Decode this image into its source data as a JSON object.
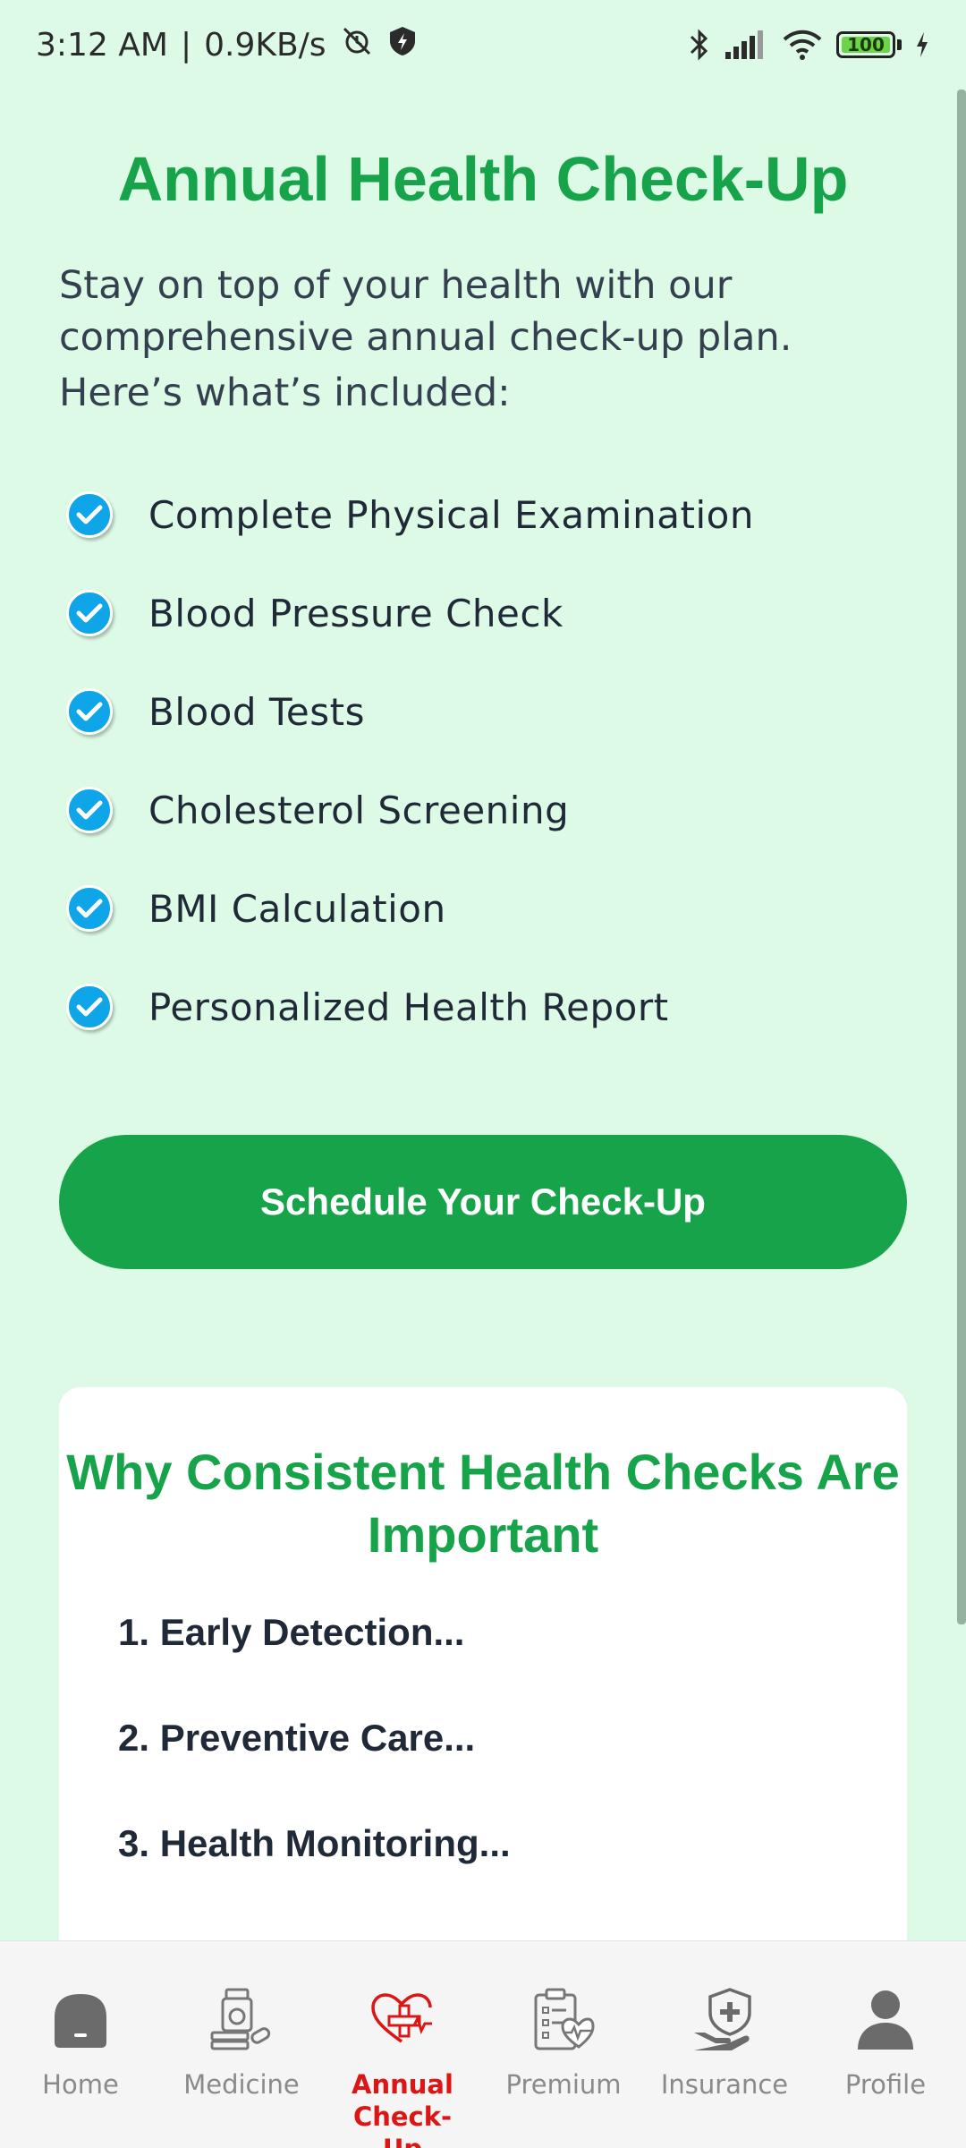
{
  "status_bar": {
    "time": "3:12 AM",
    "separator": "|",
    "speed": "0.9KB/s",
    "battery": "100",
    "battery_color": "#6fd24b"
  },
  "page": {
    "title": "Annual Health Check-Up",
    "intro_line1": "Stay on top of your health with our comprehensive annual check-up plan.",
    "intro_line2": "Here’s what’s included:",
    "accent_color": "#16a34a",
    "check_color": "#0ea5e9"
  },
  "included": [
    "Complete Physical Examination",
    "Blood Pressure Check",
    "Blood Tests",
    "Cholesterol Screening",
    "BMI Calculation",
    "Personalized Health Report"
  ],
  "cta": {
    "label": "Schedule Your Check-Up"
  },
  "importance": {
    "title": "Why Consistent Health Checks Are Important",
    "reasons": [
      "1. Early Detection...",
      "2. Preventive Care...",
      "3. Health Monitoring..."
    ]
  },
  "nav": {
    "active_color": "#dc1515",
    "items": [
      {
        "label": "Home",
        "icon": "home-icon"
      },
      {
        "label": "Medicine",
        "icon": "medicine-icon"
      },
      {
        "label": "Annual Check-Up",
        "icon": "heart-checkup-icon"
      },
      {
        "label": "Premium",
        "icon": "clipboard-heart-icon"
      },
      {
        "label": "Insurance",
        "icon": "shield-hand-icon"
      },
      {
        "label": "Profile",
        "icon": "person-icon"
      }
    ]
  }
}
